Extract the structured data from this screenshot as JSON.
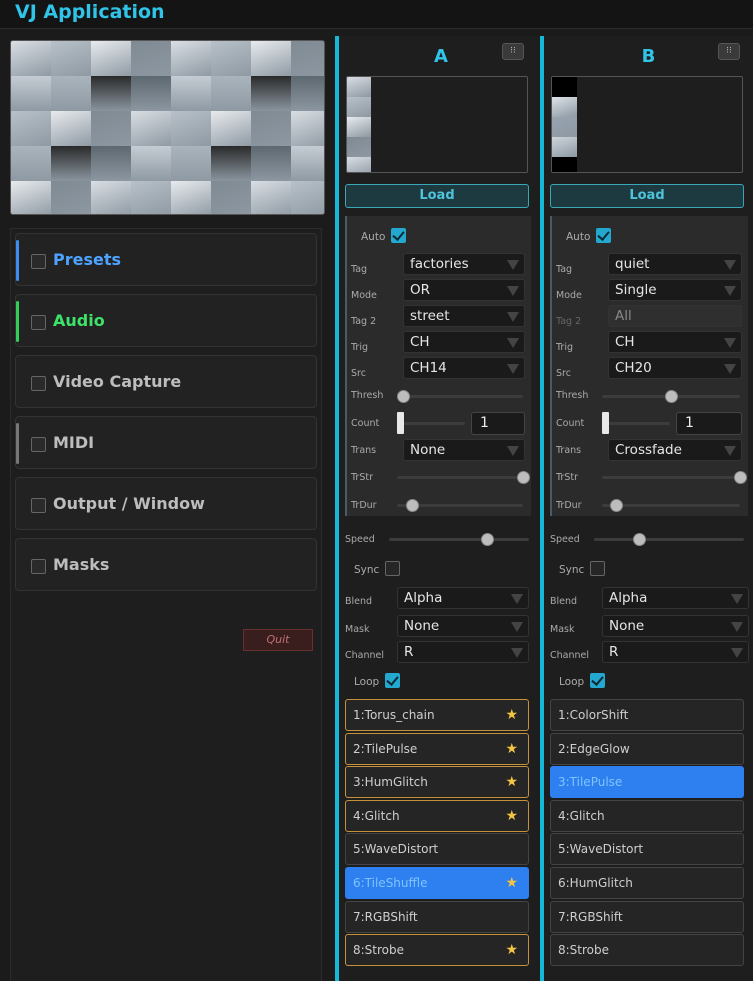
{
  "app": {
    "title": "VJ Application"
  },
  "sidebar": {
    "sections": [
      {
        "label": "Presets",
        "color": "#3d8cf0",
        "label_color": "#4da3ff",
        "checked": false
      },
      {
        "label": "Audio",
        "color": "#2fd05a",
        "label_color": "#3ee26b",
        "checked": false
      },
      {
        "label": "Video Capture",
        "color": "",
        "label_color": "#bdbdbd",
        "checked": false
      },
      {
        "label": "MIDI",
        "color": "#777777",
        "label_color": "#bdbdbd",
        "checked": false
      },
      {
        "label": "Output / Window",
        "color": "",
        "label_color": "#bdbdbd",
        "checked": false
      },
      {
        "label": "Masks",
        "color": "",
        "label_color": "#bdbdbd",
        "checked": false
      }
    ],
    "quit_label": "Quit"
  },
  "labels": {
    "auto": "Auto",
    "tag": "Tag",
    "mode": "Mode",
    "tag2": "Tag 2",
    "trig": "Trig",
    "src": "Src",
    "thresh": "Thresh",
    "count": "Count",
    "trans": "Trans",
    "trstr": "TrStr",
    "trdur": "TrDur",
    "speed": "Speed",
    "sync": "Sync",
    "blend": "Blend",
    "mask": "Mask",
    "channel": "Channel",
    "loop": "Loop"
  },
  "decks": {
    "a": {
      "title": "A",
      "load_label": "Load",
      "auto": true,
      "tag": "factories",
      "mode": "OR",
      "tag2": "street",
      "tag2_disabled": false,
      "trig": "CH",
      "src": "CH14",
      "thresh": 0.05,
      "count": "1",
      "trans": "None",
      "trstr": 1.0,
      "trdur": 0.12,
      "speed": 0.7,
      "sync": false,
      "blend": "Alpha",
      "mask": "None",
      "channel": "R",
      "loop": true,
      "presets": [
        {
          "label": "1:Torus_chain",
          "fav": true,
          "sel": false
        },
        {
          "label": "2:TilePulse",
          "fav": true,
          "sel": false
        },
        {
          "label": "3:HumGlitch",
          "fav": true,
          "sel": false
        },
        {
          "label": "4:Glitch",
          "fav": true,
          "sel": false
        },
        {
          "label": "5:WaveDistort",
          "fav": false,
          "sel": false
        },
        {
          "label": "6:TileShuffle",
          "fav": true,
          "sel": true
        },
        {
          "label": "7:RGBShift",
          "fav": false,
          "sel": false
        },
        {
          "label": "8:Strobe",
          "fav": true,
          "sel": false
        }
      ]
    },
    "b": {
      "title": "B",
      "load_label": "Load",
      "auto": true,
      "tag": "quiet",
      "mode": "Single",
      "tag2": "All",
      "tag2_disabled": true,
      "trig": "CH",
      "src": "CH20",
      "thresh": 0.5,
      "count": "1",
      "trans": "Crossfade",
      "trstr": 1.0,
      "trdur": 0.1,
      "speed": 0.3,
      "sync": false,
      "blend": "Alpha",
      "mask": "None",
      "channel": "R",
      "loop": true,
      "presets": [
        {
          "label": "1:ColorShift",
          "fav": false,
          "sel": false
        },
        {
          "label": "2:EdgeGlow",
          "fav": false,
          "sel": false
        },
        {
          "label": "3:TilePulse",
          "fav": false,
          "sel": true
        },
        {
          "label": "4:Glitch",
          "fav": false,
          "sel": false
        },
        {
          "label": "5:WaveDistort",
          "fav": false,
          "sel": false
        },
        {
          "label": "6:HumGlitch",
          "fav": false,
          "sel": false
        },
        {
          "label": "7:RGBShift",
          "fav": false,
          "sel": false
        },
        {
          "label": "8:Strobe",
          "fav": false,
          "sel": false
        }
      ]
    }
  }
}
